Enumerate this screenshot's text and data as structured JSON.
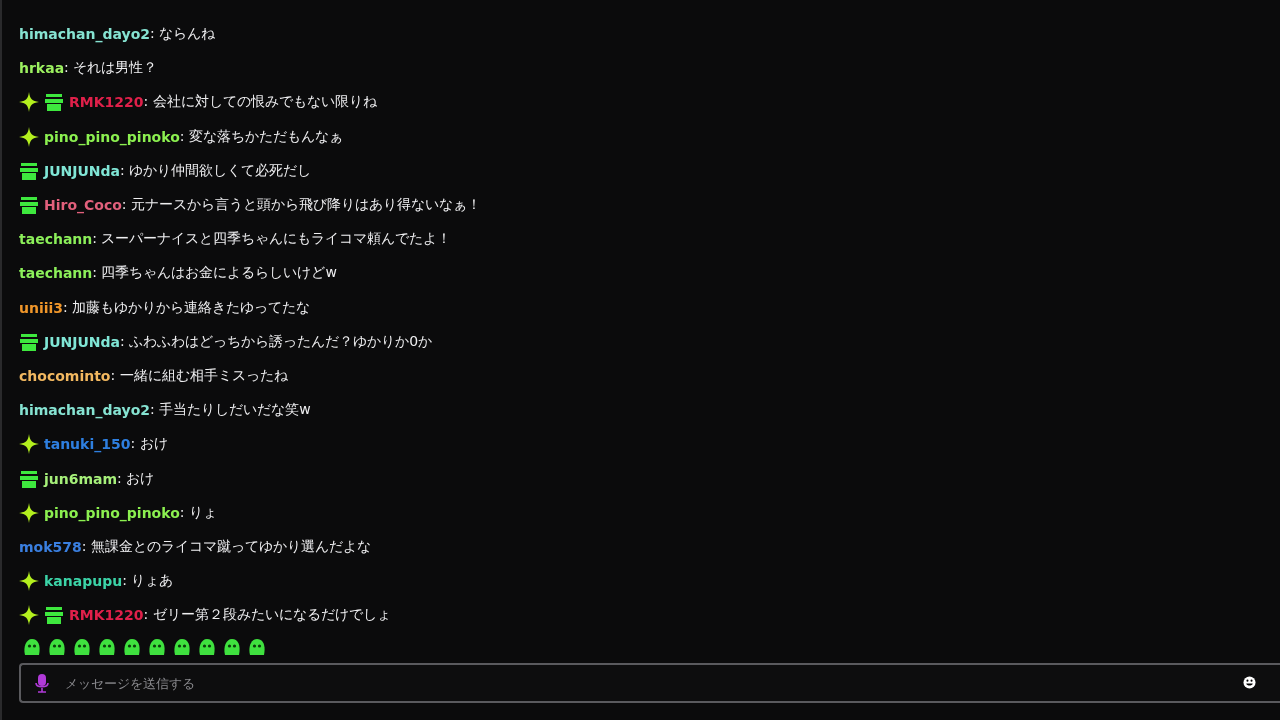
{
  "messages": [
    {
      "sparkle": false,
      "gift": false,
      "user": "himachan_dayo2",
      "color": "#86e3d2",
      "text": ": ならんね"
    },
    {
      "sparkle": false,
      "gift": false,
      "user": "hrkaa",
      "color": "#9cf060",
      "text": ": それは男性？"
    },
    {
      "sparkle": true,
      "gift": true,
      "user": "RMK1220",
      "color": "#e0204a",
      "text": ": 会社に対しての恨みでもない限りね"
    },
    {
      "sparkle": true,
      "gift": false,
      "user": "pino_pino_pinoko",
      "color": "#8cf050",
      "text": ": 変な落ちかただもんなぁ"
    },
    {
      "sparkle": false,
      "gift": true,
      "user": "JUNJUNda",
      "color": "#80e6d6",
      "text": ": ゆかり仲間欲しくて必死だし"
    },
    {
      "sparkle": false,
      "gift": true,
      "user": "Hiro_Coco",
      "color": "#e2607c",
      "text": ": 元ナースから言うと頭から飛び降りはあり得ないなぁ！"
    },
    {
      "sparkle": false,
      "gift": false,
      "user": "taechann",
      "color": "#8cf05a",
      "text": ": スーパーナイスと四季ちゃんにもライコマ頼んでたよ！"
    },
    {
      "sparkle": false,
      "gift": false,
      "user": "taechann",
      "color": "#8cf05a",
      "text": ": 四季ちゃんはお金によるらしいけどw"
    },
    {
      "sparkle": false,
      "gift": false,
      "user": "uniii3",
      "color": "#f0962a",
      "text": ": 加藤もゆかりから連絡きたゆってたな"
    },
    {
      "sparkle": false,
      "gift": true,
      "user": "JUNJUNda",
      "color": "#80e6d6",
      "text": ": ふわふわはどっちから誘ったんだ？ゆかりか0か"
    },
    {
      "sparkle": false,
      "gift": false,
      "user": "chocominto",
      "color": "#f2b860",
      "text": ": 一緒に組む相手ミスったね"
    },
    {
      "sparkle": false,
      "gift": false,
      "user": "himachan_dayo2",
      "color": "#86e3d2",
      "text": ": 手当たりしだいだな笑w"
    },
    {
      "sparkle": true,
      "gift": false,
      "user": "tanuki_150",
      "color": "#2e7fe0",
      "text": ": おけ"
    },
    {
      "sparkle": false,
      "gift": true,
      "user": "jun6mam",
      "color": "#a6f07a",
      "text": ": おけ"
    },
    {
      "sparkle": true,
      "gift": false,
      "user": "pino_pino_pinoko",
      "color": "#8cf050",
      "text": ": りょ"
    },
    {
      "sparkle": false,
      "gift": false,
      "user": "mok578",
      "color": "#3a7fe0",
      "text": ": 無課金とのライコマ蹴ってゆかり選んだよな"
    },
    {
      "sparkle": true,
      "gift": false,
      "user": "kanapupu",
      "color": "#3cd4a8",
      "text": ": りょあ"
    },
    {
      "sparkle": true,
      "gift": true,
      "user": "RMK1220",
      "color": "#e0204a",
      "text": ": ゼリー第２段みたいになるだけでしょ"
    }
  ],
  "input": {
    "placeholder": "メッセージを送信する"
  }
}
